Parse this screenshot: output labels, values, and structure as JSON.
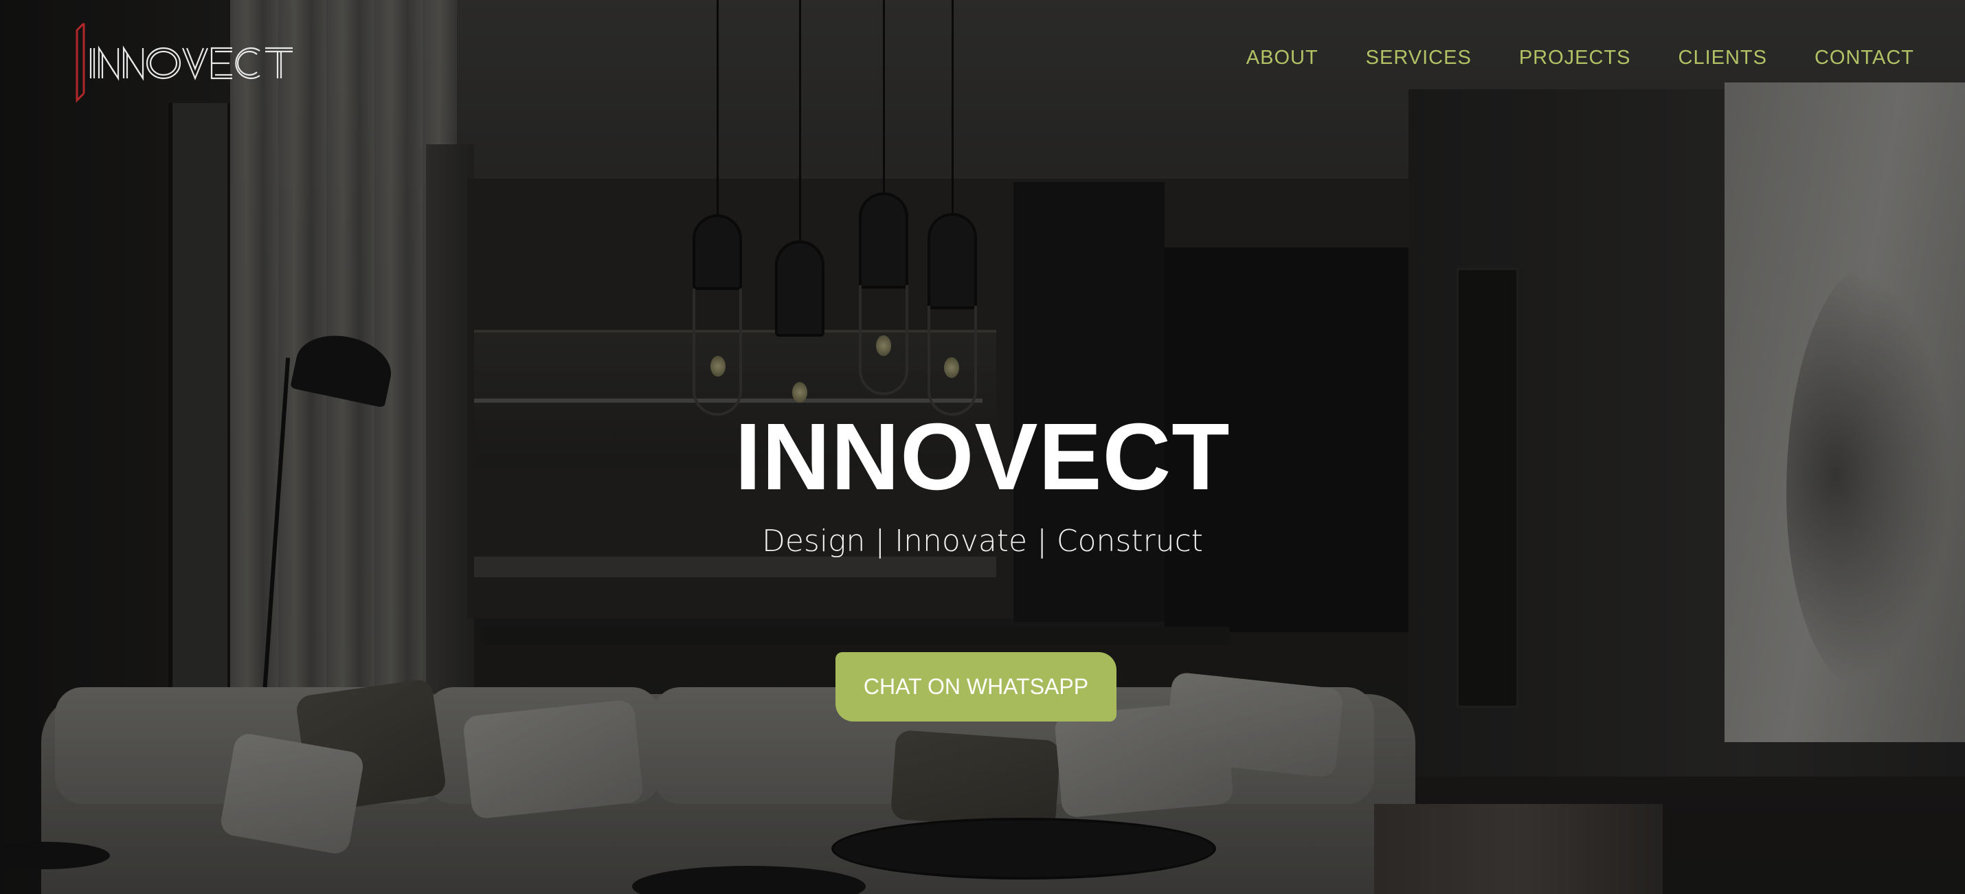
{
  "brand": {
    "logo_text": "INNOVECT",
    "logo_accent_color": "#b0272a"
  },
  "nav": {
    "items": [
      {
        "label": "ABOUT"
      },
      {
        "label": "SERVICES"
      },
      {
        "label": "PROJECTS"
      },
      {
        "label": "CLIENTS"
      },
      {
        "label": "CONTACT"
      }
    ]
  },
  "hero": {
    "title": "INNOVECT",
    "tagline": "Design | Innovate | Construct",
    "cta_label": "CHAT ON WHATSAPP"
  },
  "colors": {
    "accent": "#a8bb5c",
    "nav_text": "#b4c265",
    "title_text": "#ffffff",
    "overlay": "rgba(0,0,0,0.42)"
  },
  "icons": {
    "logo": "innovect-logo"
  }
}
